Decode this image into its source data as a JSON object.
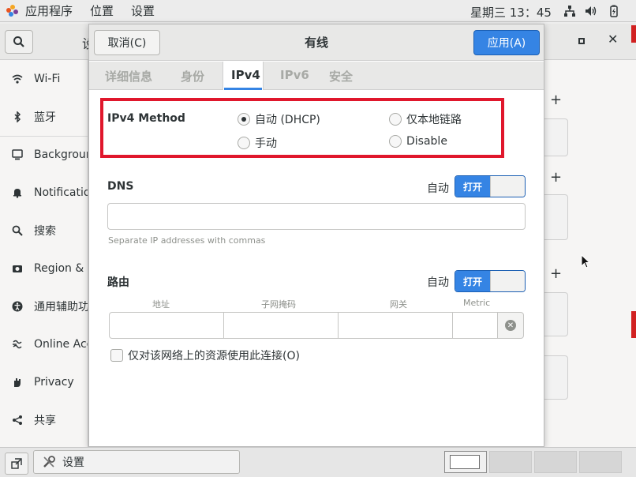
{
  "topbar": {
    "apps_menu": "应用程序",
    "places_menu": "位置",
    "settings_menu": "设置",
    "clock": "星期三 13：45"
  },
  "background_window": {
    "title_fragment": "设",
    "sidebar_items": [
      {
        "label": "Wi-Fi",
        "icon": "wifi-icon"
      },
      {
        "label": "蓝牙",
        "icon": "bluetooth-icon"
      },
      {
        "label": "Background",
        "icon": "display-icon"
      },
      {
        "label": "Notifications",
        "icon": "bell-icon"
      },
      {
        "label": "搜索",
        "icon": "search-icon"
      },
      {
        "label": "Region & Language",
        "icon": "camera-icon"
      },
      {
        "label": "通用辅助功能",
        "icon": "accessibility-icon"
      },
      {
        "label": "Online Accounts",
        "icon": "online-accounts-icon"
      },
      {
        "label": "Privacy",
        "icon": "hand-icon"
      },
      {
        "label": "共享",
        "icon": "share-icon"
      }
    ]
  },
  "dialog": {
    "cancel_label": "取消(C)",
    "title": "有线",
    "apply_label": "应用(A)",
    "tabs": [
      {
        "label": "详细信息",
        "active": false
      },
      {
        "label": "身份",
        "active": false
      },
      {
        "label": "IPv4",
        "active": true
      },
      {
        "label": "IPv6",
        "active": false
      },
      {
        "label": "安全",
        "active": false
      }
    ],
    "ipv4_method": {
      "label": "IPv4 Method",
      "options": [
        {
          "label": "自动 (DHCP)",
          "selected": true
        },
        {
          "label": "仅本地链路",
          "selected": false
        },
        {
          "label": "手动",
          "selected": false
        },
        {
          "label": "Disable",
          "selected": false
        }
      ]
    },
    "dns": {
      "label": "DNS",
      "auto_label": "自动",
      "switch_label": "打开",
      "value": "",
      "hint": "Separate IP addresses with commas"
    },
    "routes": {
      "label": "路由",
      "auto_label": "自动",
      "switch_label": "打开",
      "columns": [
        "地址",
        "子网掩码",
        "网关",
        "Metric"
      ]
    },
    "restrict_checkbox": {
      "label": "仅对该网络上的资源使用此连接(O)",
      "checked": false
    }
  },
  "taskbar": {
    "window_label": "设置"
  },
  "colors": {
    "accent": "#3584e4",
    "highlight_frame": "#e0172c"
  }
}
